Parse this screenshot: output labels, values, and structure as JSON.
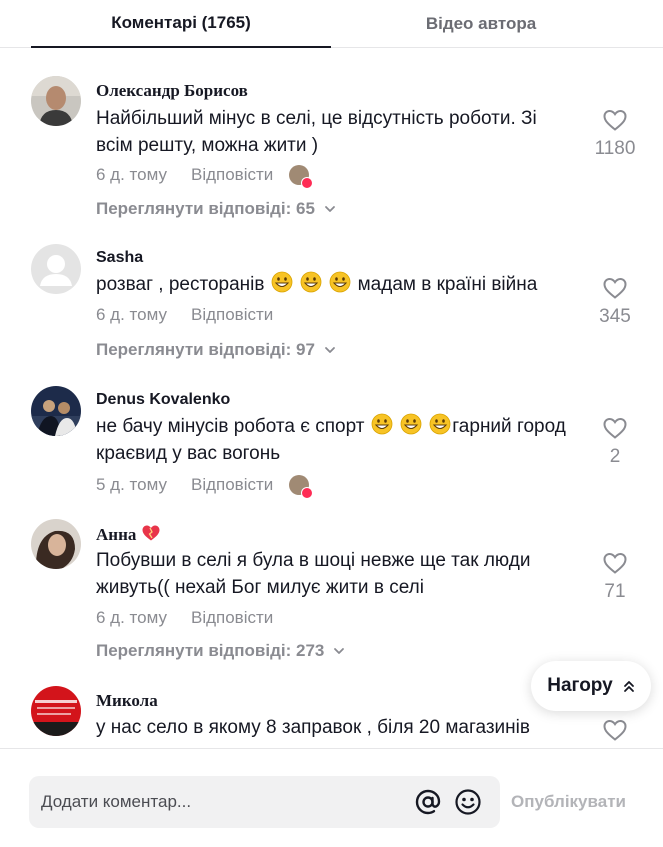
{
  "tabs": {
    "comments": "Коментарі (1765)",
    "videos": "Відео автора"
  },
  "comments": [
    {
      "author": "Олександр Борисов",
      "text": "Найбільший мінус в селі, це відсутність роботи. Зі всім решту, можна жити )",
      "time": "6 д. тому",
      "reply_label": "Відповісти",
      "likes": "1180",
      "view_replies": "Переглянути відповіді: 65"
    },
    {
      "author": "Sasha",
      "text_before": "розваг , ресторанів",
      "text_after": "мадам в країні війна",
      "emoji": "grinning-face-emoji",
      "time": "6 д. тому",
      "reply_label": "Відповісти",
      "likes": "345",
      "view_replies": "Переглянути відповіді: 97"
    },
    {
      "author": "Denus Kovalenko",
      "text_before": "не бачу мінусів робота є спорт",
      "text_after": "гарний город краєвид у вас вогонь",
      "emoji": "grinning-face-emoji",
      "time": "5 д. тому",
      "reply_label": "Відповісти",
      "likes": "2"
    },
    {
      "author": "Анна",
      "author_badge": "heart-emoji",
      "text": "Побувши в селі я була в шоці невже ще так люди живуть(( нехай Бог милує жити в селі",
      "time": "6 д. тому",
      "reply_label": "Відповісти",
      "likes": "71",
      "view_replies": "Переглянути відповіді: 273"
    },
    {
      "author": "Микола",
      "text": "у нас село в якому 8 заправок , біля 20 магазинів"
    }
  ],
  "scroll_top_label": "Нагору",
  "footer": {
    "placeholder": "Додати коментар...",
    "post_label": "Опублікувати"
  },
  "colors": {
    "text": "#161823",
    "muted": "#8a8b91",
    "accent": "#fe2c55",
    "emoji": "#f7c325"
  }
}
